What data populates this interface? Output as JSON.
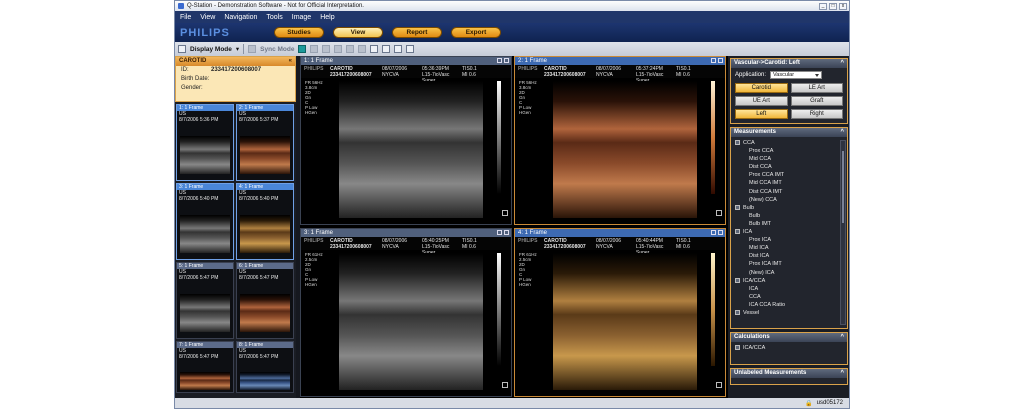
{
  "window": {
    "title": "Q-Station - Demonstration Software - Not for Official Interpretation."
  },
  "menu": [
    "File",
    "View",
    "Navigation",
    "Tools",
    "Image",
    "Help"
  ],
  "brand": "PHILIPS",
  "nav": {
    "studies": "Studies",
    "view": "View",
    "report": "Report",
    "export": "Export"
  },
  "toolbar": {
    "display_mode": "Display Mode",
    "sync_mode": "Sync Mode"
  },
  "patient": {
    "header": "CAROTID",
    "id_label": "ID:",
    "id_value": "233417200608007",
    "birth_label": "Birth Date:",
    "gender_label": "Gender:"
  },
  "thumbnails": [
    {
      "head": "1: 1 Frame",
      "mod": "US",
      "date": "8/7/2006 5:36 PM",
      "color": "gray",
      "selected": true
    },
    {
      "head": "2: 1 Frame",
      "mod": "US",
      "date": "8/7/2006 5:37 PM",
      "color": "orange",
      "selected": true
    },
    {
      "head": "3: 1 Frame",
      "mod": "US",
      "date": "8/7/2006 5:40 PM",
      "color": "gray",
      "selected": true
    },
    {
      "head": "4: 1 Frame",
      "mod": "US",
      "date": "8/7/2006 5:40 PM",
      "color": "gold",
      "selected": true
    },
    {
      "head": "5: 1 Frame",
      "mod": "US",
      "date": "8/7/2006 5:47 PM",
      "color": "gray",
      "selected": false
    },
    {
      "head": "6: 1 Frame",
      "mod": "US",
      "date": "8/7/2006 5:47 PM",
      "color": "orange",
      "selected": false
    },
    {
      "head": "7: 1 Frame",
      "mod": "US",
      "date": "8/7/2006 5:47 PM",
      "color": "orange",
      "selected": false
    },
    {
      "head": "8: 1 Frame",
      "mod": "US",
      "date": "8/7/2006 5:47 PM",
      "color": "blue",
      "selected": false
    }
  ],
  "viewports": [
    {
      "head": "1: 1 Frame",
      "brand": "PHILIPS",
      "study": "CAROTID",
      "date": "08/07/2006",
      "time": "05:36:39PM",
      "tis": "TIS0.1",
      "mi": "MI 0.6",
      "patient_id": "233417200608007",
      "site": "NYCVA",
      "probe": "L15-7ioVasc Super",
      "side_info": [
        "FR 56Hz",
        "3.8cm",
        "2D",
        "Gn",
        "C",
        "P Low",
        "HGen"
      ],
      "color": "gray",
      "active": false
    },
    {
      "head": "2: 1 Frame",
      "brand": "PHILIPS",
      "study": "CAROTID",
      "date": "08/07/2006",
      "time": "05:37:24PM",
      "tis": "TIS0.1",
      "mi": "MI 0.6",
      "patient_id": "233417200608007",
      "site": "NYCVA",
      "probe": "L15-7ioVasc Super",
      "side_info": [
        "FR 56Hz",
        "3.8cm",
        "2D",
        "Gn",
        "C",
        "P Low",
        "HGen"
      ],
      "color": "orange",
      "active": true
    },
    {
      "head": "3: 1 Frame",
      "brand": "PHILIPS",
      "study": "CAROTID",
      "date": "08/07/2006",
      "time": "05:40:25PM",
      "tis": "TIS0.1",
      "mi": "MI 0.6",
      "patient_id": "233417200608007",
      "site": "NYCVA",
      "probe": "L15-7ioVasc Super",
      "side_info": [
        "FR 61Hz",
        "2.5cm",
        "2D",
        "Gn",
        "C",
        "P Low",
        "HGen"
      ],
      "color": "gray",
      "active": false
    },
    {
      "head": "4: 1 Frame",
      "brand": "PHILIPS",
      "study": "CAROTID",
      "date": "08/07/2006",
      "time": "05:40:44PM",
      "tis": "TIS0.1",
      "mi": "MI 0.6",
      "patient_id": "233417200608007",
      "site": "NYCVA",
      "probe": "L15-7ioVasc Super",
      "side_info": [
        "FR 61Hz",
        "2.5cm",
        "2D",
        "Gn",
        "C",
        "P Low",
        "HGen"
      ],
      "color": "gold",
      "active": true
    }
  ],
  "right": {
    "app_title": "Vascular->Carotid: Left",
    "application_label": "Application:",
    "application_value": "Vascular",
    "buttons": [
      {
        "label": "Carotid",
        "on": true
      },
      {
        "label": "LE Art",
        "on": false
      },
      {
        "label": "UE Art",
        "on": false
      },
      {
        "label": "Graft",
        "on": false
      },
      {
        "label": "Left",
        "on": true
      },
      {
        "label": "Right",
        "on": false
      }
    ],
    "measurements_title": "Measurements",
    "measurements": [
      {
        "label": "CCA",
        "group": true
      },
      {
        "label": "Prox CCA",
        "group": false
      },
      {
        "label": "Mid CCA",
        "group": false
      },
      {
        "label": "Dist CCA",
        "group": false
      },
      {
        "label": "Prox CCA IMT",
        "group": false
      },
      {
        "label": "Mid CCA IMT",
        "group": false
      },
      {
        "label": "Dist CCA IMT",
        "group": false
      },
      {
        "label": "(New) CCA",
        "group": false
      },
      {
        "label": "Bulb",
        "group": true
      },
      {
        "label": "Bulb",
        "group": false
      },
      {
        "label": "Bulb IMT",
        "group": false
      },
      {
        "label": "ICA",
        "group": true
      },
      {
        "label": "Prox ICA",
        "group": false
      },
      {
        "label": "Mid ICA",
        "group": false
      },
      {
        "label": "Dist ICA",
        "group": false
      },
      {
        "label": "Prox ICA IMT",
        "group": false
      },
      {
        "label": "(New) ICA",
        "group": false
      },
      {
        "label": "ICA/CCA",
        "group": true
      },
      {
        "label": "ICA",
        "group": false
      },
      {
        "label": "CCA",
        "group": false
      },
      {
        "label": "ICA CCA Ratio",
        "group": false
      },
      {
        "label": "Vessel",
        "group": true
      }
    ],
    "calculations_title": "Calculations",
    "calculations": [
      "ICA/CCA"
    ],
    "unlabeled_title": "Unlabeled Measurements"
  },
  "status": {
    "user": "usd05172"
  }
}
